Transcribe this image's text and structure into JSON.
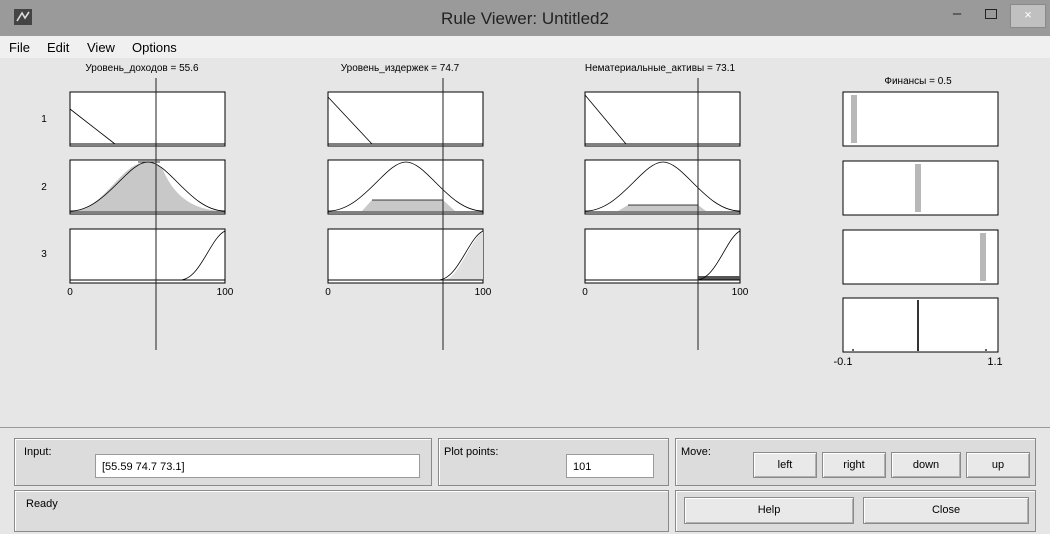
{
  "window": {
    "title": "Rule Viewer: Untitled2",
    "minimize": "–",
    "close": "×"
  },
  "menu": [
    "File",
    "Edit",
    "View",
    "Options"
  ],
  "inputs": [
    {
      "header": "Уровень_доходов = 55.6",
      "value": 55.6,
      "range": [
        0,
        100
      ],
      "tick_min": "0",
      "tick_max": "100"
    },
    {
      "header": "Уровень_издержек = 74.7",
      "value": 74.7,
      "range": [
        0,
        100
      ],
      "tick_min": "0",
      "tick_max": "100"
    },
    {
      "header": "Нематериальные_активы = 73.1",
      "value": 73.1,
      "range": [
        0,
        100
      ],
      "tick_min": "0",
      "tick_max": "100"
    }
  ],
  "output": {
    "header": "Финансы = 0.5",
    "value": 0.5,
    "range": [
      -0.1,
      1.1
    ],
    "tick_min": "-0.1",
    "tick_max": "1.1"
  },
  "rules": [
    "1",
    "2",
    "3"
  ],
  "controls": {
    "input_label": "Input:",
    "input_value": "[55.59 74.7 73.1]",
    "plot_points_label": "Plot points:",
    "plot_points_value": "101",
    "move_label": "Move:",
    "left": "left",
    "right": "right",
    "down": "down",
    "up": "up",
    "status": "Ready",
    "help": "Help",
    "close": "Close"
  },
  "colors": {
    "titlebar": "#9a9a9a",
    "background": "#e6e6e6",
    "fill": "#c8c8c8"
  }
}
